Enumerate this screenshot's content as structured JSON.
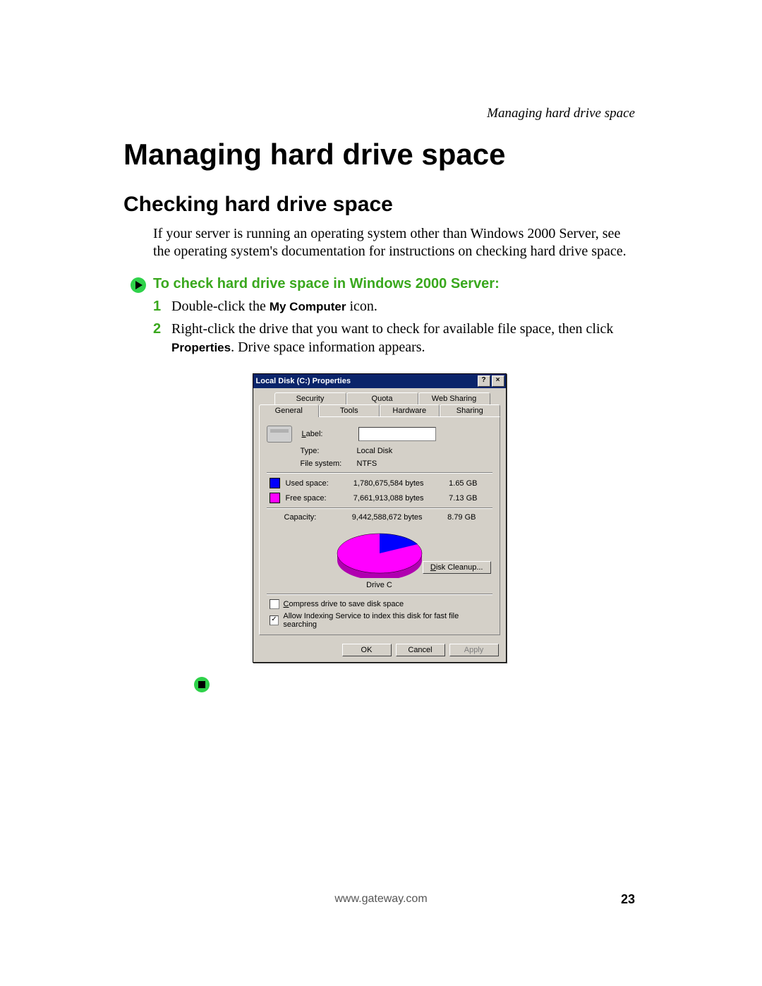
{
  "running_head": "Managing hard drive space",
  "h1": "Managing hard drive space",
  "h2": "Checking hard drive space",
  "intro": "If your server is running an operating system other than Windows 2000 Server, see the operating system's documentation for instructions on checking hard drive space.",
  "proc_title": "To check hard drive space in Windows 2000 Server:",
  "steps": {
    "s1_a": "Double-click the ",
    "s1_bold": "My Computer",
    "s1_b": " icon.",
    "s2_a": "Right-click the drive that you want to check for available file space, then click ",
    "s2_bold": "Properties",
    "s2_b": ". Drive space information appears."
  },
  "dialog": {
    "title": "Local Disk (C:) Properties",
    "help_btn": "?",
    "close_btn": "×",
    "tabs_back": [
      "Security",
      "Quota",
      "Web Sharing"
    ],
    "tabs_front": [
      "General",
      "Tools",
      "Hardware",
      "Sharing"
    ],
    "label_label": "Label:",
    "type_label": "Type:",
    "type_value": "Local Disk",
    "fs_label": "File system:",
    "fs_value": "NTFS",
    "used_label": "Used space:",
    "used_bytes": "1,780,675,584 bytes",
    "used_gb": "1.65 GB",
    "free_label": "Free space:",
    "free_bytes": "7,661,913,088 bytes",
    "free_gb": "7.13 GB",
    "cap_label": "Capacity:",
    "cap_bytes": "9,442,588,672 bytes",
    "cap_gb": "8.79 GB",
    "drive_label": "Drive C",
    "cleanup_btn": "Disk Cleanup...",
    "chk_compress": "Compress drive to save disk space",
    "chk_index": "Allow Indexing Service to index this disk for fast file searching",
    "ok": "OK",
    "cancel": "Cancel",
    "apply": "Apply"
  },
  "chart_data": {
    "type": "pie",
    "title": "Drive C",
    "series": [
      {
        "name": "Used space",
        "value": 1.65,
        "unit": "GB",
        "color": "#0000ff"
      },
      {
        "name": "Free space",
        "value": 7.13,
        "unit": "GB",
        "color": "#ff00ff"
      }
    ],
    "total": {
      "name": "Capacity",
      "value": 8.79,
      "unit": "GB"
    }
  },
  "footer_url": "www.gateway.com",
  "page_number": "23"
}
